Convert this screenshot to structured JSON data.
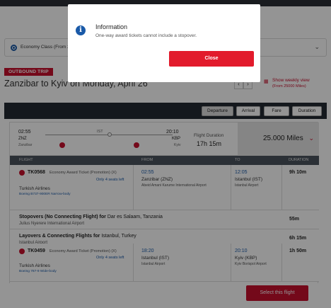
{
  "cabin": {
    "label": "Economy Class (From 25"
  },
  "outbound_badge": "OUTBOUND TRIP",
  "route_title": "Zanzibar to Kyiv on Monday, April 26",
  "pager": {
    "prev": "‹",
    "next": "›"
  },
  "weekly": {
    "label": "Show weekly view",
    "sub": "(From 25000 Miles)"
  },
  "sort": {
    "departure": "Departure",
    "arrival": "Arrival",
    "fare": "Fare",
    "duration": "Duration"
  },
  "summary": {
    "dep_time": "02:55",
    "dep_code": "ZNZ",
    "dep_city": "Zanzibar",
    "via": "IST",
    "arr_time": "20:10",
    "arr_code": "KBP",
    "arr_city": "Kyiv",
    "duration_label": "Flight Duration",
    "duration": "17h 15m",
    "miles": "25.000 Miles"
  },
  "table": {
    "headers": {
      "flight": "FLIGHT",
      "from": "FROM",
      "to": "TO",
      "duration": "DURATION"
    },
    "flight1": {
      "number": "TK0568",
      "ticket": "Economy Award Ticket (Promotion) (X)",
      "seats": "Only 4 seats left",
      "airline": "Turkish Airlines",
      "aircraft": "Boeing B737-900ER Narrow-body",
      "from_time": "02:55",
      "from_city": "Zanzibar (ZNZ)",
      "from_airport": "Abeid Amani Karume International Airport",
      "to_time": "12:05",
      "to_city": "Istanbul (IST)",
      "to_airport": "Istanbul Airport",
      "duration": "9h 10m"
    },
    "stopover": {
      "title": "Stopovers (No Connecting Flight) for",
      "place": "Dar es Salaam, Tanzania",
      "airport": "Julius Nyerere International Airport",
      "duration": "55m"
    },
    "layover": {
      "title": "Layovers & Connecting Flights for",
      "place": "Istanbul, Turkey",
      "airport": "Istanbul Airport",
      "duration": "6h 15m"
    },
    "flight2": {
      "number": "TK0459",
      "ticket": "Economy Award Ticket (Promotion) (X)",
      "seats": "Only 4 seats left",
      "airline": "Turkish Airlines",
      "aircraft": "Boeing 787-9 Wide-body",
      "from_time": "18:20",
      "from_city": "Istanbul (IST)",
      "from_airport": "Istanbul Airport",
      "to_time": "20:10",
      "to_city": "Kyiv (KBP)",
      "to_airport": "Kyiv Borispol Airport",
      "duration": "1h 50m"
    }
  },
  "select_button": "Select this flight",
  "modal": {
    "icon": "info-icon",
    "title": "Information",
    "message": "One-way award tickets cannot include a stopover.",
    "close": "Close"
  },
  "colors": {
    "brand_red": "#c8102e",
    "link_blue": "#1a5aa8",
    "header_dark": "#232a33"
  }
}
